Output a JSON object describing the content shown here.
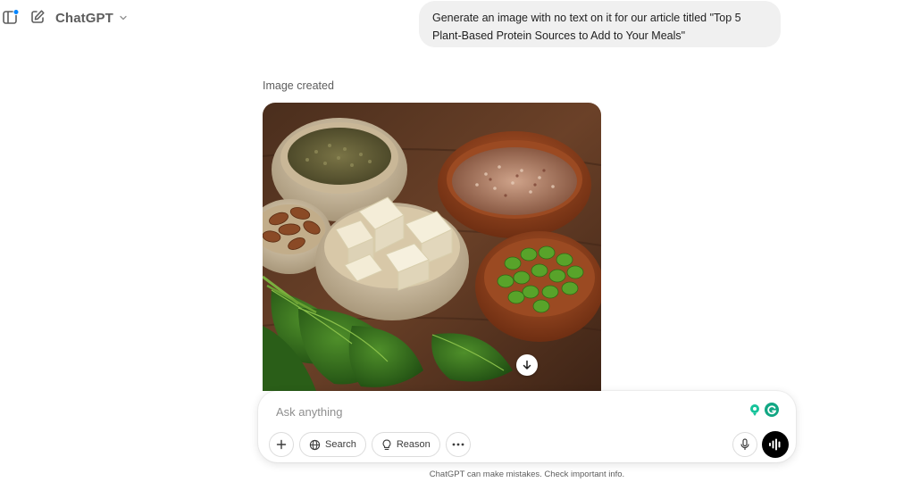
{
  "header": {
    "model_name": "ChatGPT",
    "icons": [
      "sidebar-icon",
      "new-chat-icon",
      "chevron-down-icon"
    ]
  },
  "conversation": {
    "user_message": "Generate an image with no text on it for our article titled \"Top 5 Plant-Based Protein Sources to Add to Your Meals\"",
    "assistant": {
      "status": "Image created",
      "image_subject": "bowls of lentils, quinoa, almonds, tofu cubes, edamame and spinach leaves on a wooden table",
      "download_icon": "arrow-down-icon"
    }
  },
  "composer": {
    "placeholder": "Ask anything",
    "value": "",
    "tools": {
      "add_icon": "plus-icon",
      "search_label": "Search",
      "reason_label": "Reason",
      "more_icon": "ellipsis-icon"
    },
    "extension_icons": [
      "grammarly-assistant-icon",
      "grammarly-icon"
    ],
    "mic_icon": "microphone-icon",
    "voice_icon": "voice-mode-icon"
  },
  "footer": {
    "disclaimer": "ChatGPT can make mistakes. Check important info."
  },
  "colors": {
    "bubble_bg": "#f0f0f0",
    "grammarly_green": "#15c39a",
    "grammarly_teal": "#11a683",
    "accent_black": "#000000",
    "notification_blue": "#0285ff"
  }
}
